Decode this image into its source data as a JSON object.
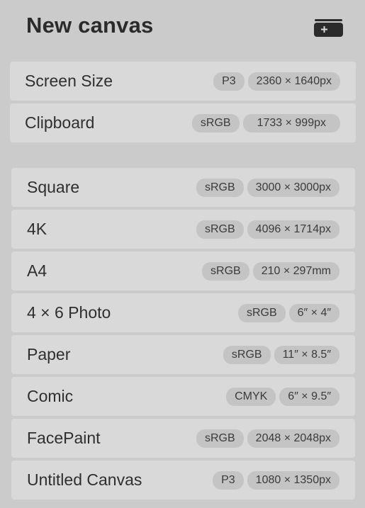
{
  "header": {
    "title": "New canvas",
    "add_icon": "plus-card-icon"
  },
  "quick_items": [
    {
      "name": "Screen Size",
      "profile": "P3",
      "dims": "2360 × 1640px"
    },
    {
      "name": "Clipboard",
      "profile": "sRGB",
      "dims": "1733 × 999px"
    }
  ],
  "templates": [
    {
      "name": "Square",
      "profile": "sRGB",
      "dims": "3000 × 3000px"
    },
    {
      "name": "4K",
      "profile": "sRGB",
      "dims": "4096 × 1714px"
    },
    {
      "name": "A4",
      "profile": "sRGB",
      "dims": "210 × 297mm"
    },
    {
      "name": "4 × 6 Photo",
      "profile": "sRGB",
      "dims": "6″ × 4″"
    },
    {
      "name": "Paper",
      "profile": "sRGB",
      "dims": "11″ × 8.5″"
    },
    {
      "name": "Comic",
      "profile": "CMYK",
      "dims": "6″ × 9.5″"
    },
    {
      "name": "FacePaint",
      "profile": "sRGB",
      "dims": "2048 × 2048px"
    },
    {
      "name": "Untitled Canvas",
      "profile": "P3",
      "dims": "1080 × 1350px"
    }
  ]
}
